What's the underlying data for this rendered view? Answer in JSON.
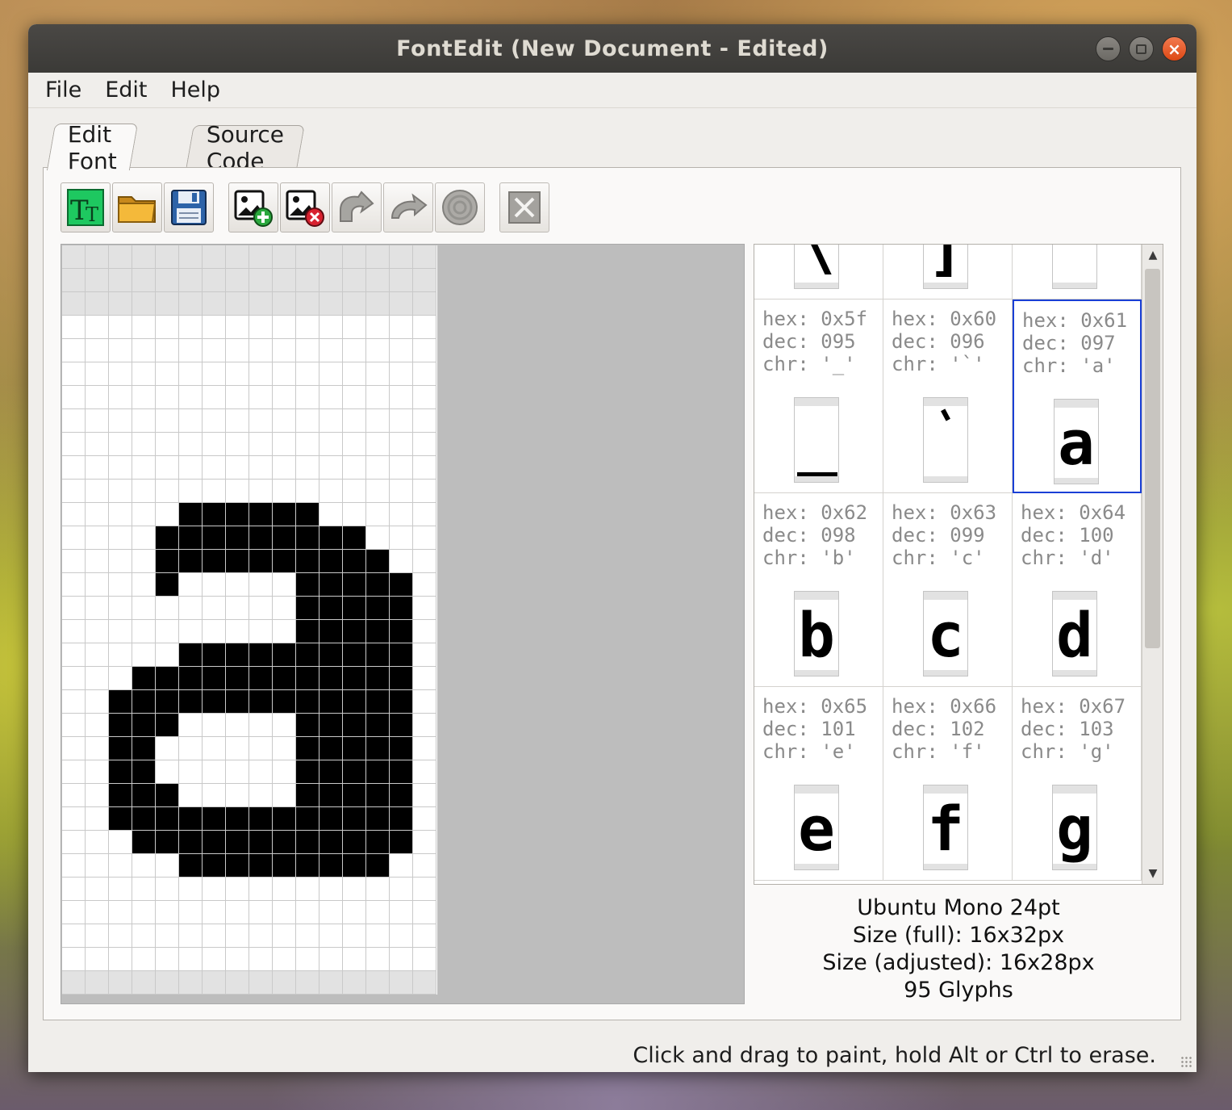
{
  "window": {
    "title": "FontEdit (New Document - Edited)"
  },
  "menu": [
    "File",
    "Edit",
    "Help"
  ],
  "tabs": [
    {
      "label": "Edit Font",
      "active": true
    },
    {
      "label": "Source Code",
      "active": false
    }
  ],
  "toolbar": [
    {
      "name": "new-font-button",
      "icon": "new-font-icon",
      "enabled": true
    },
    {
      "name": "open-button",
      "icon": "folder-icon",
      "enabled": true
    },
    {
      "name": "save-button",
      "icon": "floppy-icon",
      "enabled": true
    },
    {
      "name": "add-glyph-button",
      "icon": "add-glyph-icon",
      "enabled": true
    },
    {
      "name": "delete-glyph-button",
      "icon": "delete-glyph-icon",
      "enabled": true
    },
    {
      "name": "undo-button",
      "icon": "undo-icon",
      "enabled": false
    },
    {
      "name": "redo-button",
      "icon": "redo-icon",
      "enabled": false
    },
    {
      "name": "reset-glyph-button",
      "icon": "reset-icon",
      "enabled": false
    },
    {
      "name": "close-button",
      "icon": "close-icon",
      "enabled": false
    }
  ],
  "editor": {
    "columns": 16,
    "rows": 32,
    "shaded_rows_top": [
      0,
      1,
      2
    ],
    "shaded_rows_bottom": [
      31
    ],
    "pixels": [
      "................",
      "................",
      "................",
      "................",
      "................",
      "................",
      "................",
      "................",
      "................",
      "................",
      "................",
      ".....######.....",
      "....#########...",
      "....##########..",
      "....#.....#####.",
      "..........#####.",
      "..........#####.",
      ".....##########.",
      "...############.",
      "..#############.",
      "..###.....#####.",
      "..##......#####.",
      "..##......#####.",
      "..###.....#####.",
      "..#############.",
      "...############.",
      ".....#########..",
      "................",
      "................",
      "................",
      "................",
      "................"
    ]
  },
  "glyphs": {
    "top_row_chars": [
      "\\",
      "]",
      "^"
    ],
    "cells": [
      {
        "hex": "0x5f",
        "dec": "095",
        "chr": "'_'",
        "glyph": "_"
      },
      {
        "hex": "0x60",
        "dec": "096",
        "chr": "'`'",
        "glyph": "`"
      },
      {
        "hex": "0x61",
        "dec": "097",
        "chr": "'a'",
        "glyph": "a",
        "selected": true
      },
      {
        "hex": "0x62",
        "dec": "098",
        "chr": "'b'",
        "glyph": "b"
      },
      {
        "hex": "0x63",
        "dec": "099",
        "chr": "'c'",
        "glyph": "c"
      },
      {
        "hex": "0x64",
        "dec": "100",
        "chr": "'d'",
        "glyph": "d"
      },
      {
        "hex": "0x65",
        "dec": "101",
        "chr": "'e'",
        "glyph": "e"
      },
      {
        "hex": "0x66",
        "dec": "102",
        "chr": "'f'",
        "glyph": "f"
      },
      {
        "hex": "0x67",
        "dec": "103",
        "chr": "'g'",
        "glyph": "g"
      }
    ]
  },
  "font_info": {
    "name": "Ubuntu Mono 24pt",
    "size_full": "Size (full): 16x32px",
    "size_adjusted": "Size (adjusted): 16x28px",
    "glyph_count": "95 Glyphs"
  },
  "status": "Click and drag to paint, hold Alt or Ctrl to erase.",
  "colors": {
    "selection_border": "#1a3fd6",
    "close_button": "#dd4814",
    "titlebar": "#3b3a37"
  }
}
